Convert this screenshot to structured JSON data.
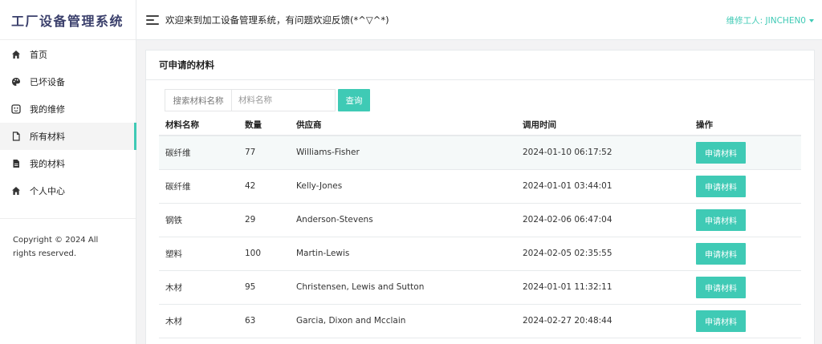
{
  "app": {
    "logo": "工厂设备管理系统",
    "welcome": "欢迎来到加工设备管理系统，有问题欢迎反馈(*^▽^*)",
    "user_label": "维修工人: JINCHEN0"
  },
  "sidebar": {
    "items": [
      {
        "label": "首页",
        "icon": "home-icon"
      },
      {
        "label": "已坏设备",
        "icon": "palette-icon"
      },
      {
        "label": "我的维修",
        "icon": "face-icon"
      },
      {
        "label": "所有材料",
        "icon": "file-icon",
        "active": true
      },
      {
        "label": "我的材料",
        "icon": "document-icon"
      },
      {
        "label": "个人中心",
        "icon": "home-icon"
      }
    ],
    "copyright": "Copyright © 2024 All rights reserved."
  },
  "panel": {
    "title": "可申请的材料",
    "search": {
      "label": "搜索材料名称",
      "placeholder": "材料名称",
      "button": "查询"
    },
    "table": {
      "headers": [
        "材料名称",
        "数量",
        "供应商",
        "调用时间",
        "操作"
      ],
      "action_label": "申请材料",
      "rows": [
        {
          "name": "碳纤维",
          "qty": "77",
          "supplier": "Williams-Fisher",
          "time": "2024-01-10 06:17:52"
        },
        {
          "name": "碳纤维",
          "qty": "42",
          "supplier": "Kelly-Jones",
          "time": "2024-01-01 03:44:01"
        },
        {
          "name": "钢铁",
          "qty": "29",
          "supplier": "Anderson-Stevens",
          "time": "2024-02-06 06:47:04"
        },
        {
          "name": "塑料",
          "qty": "100",
          "supplier": "Martin-Lewis",
          "time": "2024-02-05 02:35:55"
        },
        {
          "name": "木材",
          "qty": "95",
          "supplier": "Christensen, Lewis and Sutton",
          "time": "2024-01-01 11:32:11"
        },
        {
          "name": "木材",
          "qty": "63",
          "supplier": "Garcia, Dixon and Mcclain",
          "time": "2024-02-27 20:48:44"
        }
      ]
    }
  },
  "colors": {
    "accent": "#3fcab5",
    "highlight_row": "#f5f9f9"
  }
}
